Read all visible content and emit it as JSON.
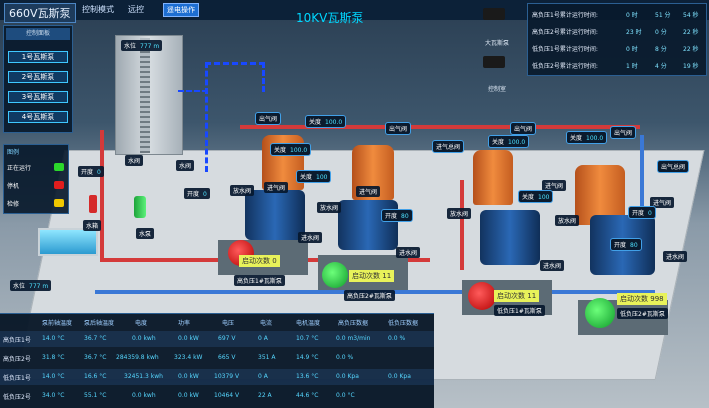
{
  "header": {
    "title": "660V瓦斯泵",
    "control_mode": "控制模式",
    "remote": "远控",
    "local_op": "遥电操作",
    "center_title": "10KV瓦斯泵"
  },
  "control_panel": {
    "header": "控制面板",
    "items": [
      "1号瓦斯泵",
      "2号瓦斯泵",
      "3号瓦斯泵",
      "4号瓦斯泵"
    ]
  },
  "runtime": {
    "rows": [
      {
        "label": "高负压1号累计运行时间:",
        "h": "0 时",
        "m": "51 分",
        "s": "54 秒"
      },
      {
        "label": "高负压2号累计运行时间:",
        "h": "23 时",
        "m": "0 分",
        "s": "22 秒"
      },
      {
        "label": "低负压1号累计运行时间:",
        "h": "0 时",
        "m": "8 分",
        "s": "22 秒"
      },
      {
        "label": "低负压2号累计运行时间:",
        "h": "1 时",
        "m": "4 分",
        "s": "19 秒"
      }
    ]
  },
  "cameras": {
    "big": "大瓦斯泵",
    "control": "控制室"
  },
  "legend": {
    "title": "图例",
    "running": "正在运行",
    "stopped": "停机",
    "maintenance": "检修"
  },
  "levels": {
    "top": "水位",
    "top_val": "777 m",
    "bottom": "水位",
    "bottom_val": "777 m"
  },
  "scene_labels": {
    "water_valve_1": "水阀",
    "water_valve_2": "水阀",
    "water_tank": "水箱",
    "water_pump": "水泵",
    "opening_1": "开度",
    "opening_1_val": "0",
    "opening_2": "开度",
    "opening_2_val": "0",
    "outlet_valve_1": "出气阀",
    "close_1": "关度",
    "close_1_val": "100.0",
    "outlet_valve_2": "出气阀",
    "close_2": "关度",
    "close_2_val": "100.0",
    "outlet_valve_3": "出气阀",
    "close_3": "关度",
    "close_3_val": "100.0",
    "outlet_valve_4": "出气阀",
    "close_4": "关度",
    "close_4_val": "100.0",
    "total_outlet": "出气总阀",
    "inlet_total": "进气总阀",
    "inlet_valve_1": "进气阀",
    "inlet_valve_2": "进气阀",
    "inlet_valve_3": "进气阀",
    "inlet_valve_4": "进气阀",
    "drain_valve_1": "放水阀",
    "drain_valve_2": "放水阀",
    "drain_valve_3": "放水阀",
    "drain_valve_4": "放水阀",
    "inwater_valve_1": "进水阀",
    "inwater_valve_2": "进水阀",
    "inwater_valve_3": "进水阀",
    "inwater_valve_4": "进水阀",
    "close_mid_1": "关度",
    "close_mid_1_val": "100",
    "close_mid_2": "关度",
    "close_mid_2_val": "100",
    "open_mid_1": "开度",
    "open_mid_1_val": "80",
    "open_mid_2": "开度",
    "open_mid_2_val": "80",
    "open_mid_3": "开度",
    "open_mid_3_val": "0"
  },
  "pumps": [
    {
      "count_label": "启动次数",
      "count": "0",
      "name": "高负压1#瓦斯泵"
    },
    {
      "count_label": "启动次数",
      "count": "11",
      "name": "高负压2#瓦斯泵"
    },
    {
      "count_label": "启动次数",
      "count": "11",
      "name": "低负压1#瓦斯泵"
    },
    {
      "count_label": "启动次数",
      "count": "998",
      "name": "低负压2#瓦斯泵"
    }
  ],
  "table": {
    "headers": [
      "泵前轴温度",
      "泵后轴温度",
      "电度",
      "功率",
      "电压",
      "电流",
      "电机温度",
      "高负压数据",
      "低负压数据"
    ],
    "rows": [
      {
        "label": "高负压1号",
        "cells": [
          "14.0 °C",
          "36.7 °C",
          "0.0 kwh",
          "0.0 kW",
          "697 V",
          "0 A",
          "10.7 °C",
          "0.0 m3/min",
          "0.0 %"
        ]
      },
      {
        "label": "高负压2号",
        "cells": [
          "31.8 °C",
          "36.7 °C",
          "284359.8 kwh",
          "323.4 kW",
          "665 V",
          "351 A",
          "14.9 °C",
          "0.0 %",
          ""
        ]
      },
      {
        "label": "低负压1号",
        "cells": [
          "14.0 °C",
          "16.6 °C",
          "32451.3 kwh",
          "0.0 kW",
          "10379 V",
          "0 A",
          "13.6 °C",
          "0.0 Kpa",
          "0.0 Kpa"
        ]
      },
      {
        "label": "低负压2号",
        "cells": [
          "34.0 °C",
          "55.1 °C",
          "0.0 kwh",
          "0.0 kW",
          "10464 V",
          "22 A",
          "44.6 °C",
          "0.0 °C",
          ""
        ]
      }
    ]
  },
  "colors": {
    "accent": "#00d7ff",
    "running": "#2bd82b",
    "stopped": "#e11d1d",
    "maintenance": "#f0c800"
  }
}
